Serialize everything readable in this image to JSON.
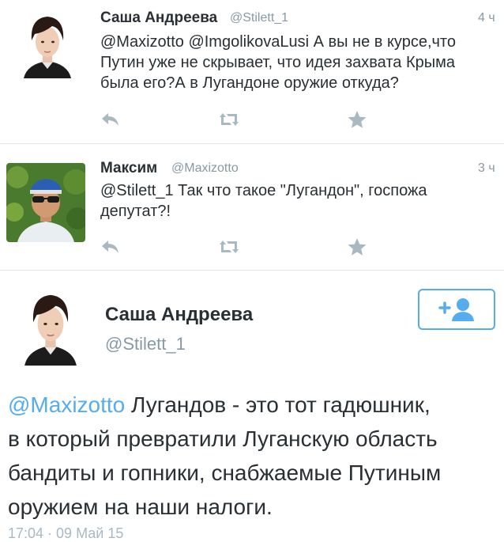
{
  "tweets": [
    {
      "name": "Саша Андреева",
      "handle": "@Stilett_1",
      "time": "4 ч",
      "text_lines": [
        "@Maxizotto @ImgolikovaLusi А вы не в  курсе,что",
        "Путин уже не скрывает, что идея захвата Крыма",
        "была его?А в Лугандоне оружие откуда?"
      ]
    },
    {
      "name": "Максим",
      "handle": "@Maxizotto",
      "time": "3 ч",
      "text_lines": [
        "@Stilett_1 Так что такое \"Лугандон\", госпожа",
        "депутат?!"
      ]
    }
  ],
  "detail": {
    "name": "Саша Андреева",
    "handle": "@Stilett_1",
    "mention": "@Maxizotto",
    "text_first": " Лугандов - это тот гадюшник,",
    "text_lines": [
      "в который превратили Луганскую область",
      "бандиты и гопники, снабжаемые Путиным",
      "оружием на наши налоги."
    ],
    "timestamp": "17:04 · 09 Май 15"
  },
  "icons": {
    "reply": "reply-icon",
    "retweet": "retweet-icon",
    "favorite": "star-icon",
    "follow": "follow-add-user-icon"
  },
  "colors": {
    "accent": "#55acee",
    "action_icon": "#aab8c2",
    "secondary_text": "#8899a6"
  }
}
